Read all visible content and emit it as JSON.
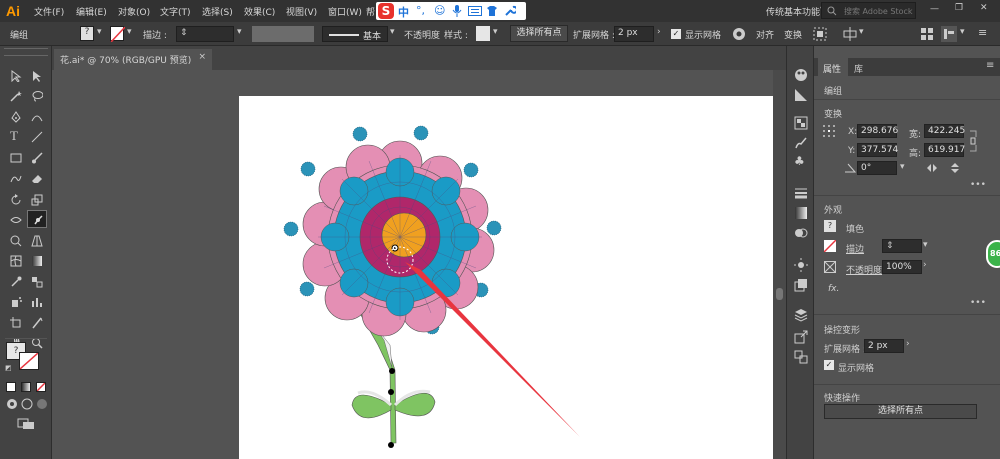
{
  "app": {
    "logo": "Ai"
  },
  "menu": [
    "文件(F)",
    "编辑(E)",
    "对象(O)",
    "文字(T)",
    "选择(S)",
    "效果(C)",
    "视图(V)",
    "窗口(W)",
    "帮"
  ],
  "ime": {
    "logo": "S",
    "mode": "中"
  },
  "workspace": "传统基本功能",
  "search": {
    "placeholder": "搜索 Adobe Stock"
  },
  "control": {
    "group_label": "编组",
    "stroke_label": "描边 :",
    "stroke_style": "基本",
    "opacity_label": "不透明度",
    "style_label": "样式 :",
    "select_all_button": "选择所有点",
    "expand_mesh_label": "扩展网格 :",
    "expand_mesh_value": "2 px",
    "show_mesh_label": "显示网格",
    "align_label": "对齐",
    "transform_label": "变换"
  },
  "document_tab": {
    "title": "花.ai* @ 70% (RGB/GPU 预览)",
    "close": "×"
  },
  "panel": {
    "tabs": [
      "属性",
      "库"
    ],
    "group_label": "编组",
    "transform_title": "变换",
    "x_label": "X:",
    "x_value": "298.676",
    "y_label": "Y:",
    "y_value": "377.574",
    "w_label": "宽:",
    "w_value": "422.245",
    "h_label": "高:",
    "h_value": "619.917",
    "angle_value": "0°",
    "more": "•••",
    "appearance_title": "外观",
    "fill_label": "填色",
    "stroke_label": "描边",
    "opacity_label": "不透明度",
    "opacity_value": "100%",
    "fx_label": "fx.",
    "puppet_title": "操控变形",
    "expand_mesh_label": "扩展网格 :",
    "expand_mesh_value": "2 px",
    "show_mesh_label": "显示网格",
    "quick_actions_title": "快速操作",
    "select_all_button": "选择所有点"
  },
  "badge": "86",
  "colors": {
    "petal_pink": "#e48fb4",
    "petal_teal": "#1a9bc6",
    "ring_magenta": "#b0276a",
    "center_orange": "#f0a020",
    "stem_green": "#7fc462",
    "arrow_red": "#e8353f",
    "dot_teal": "#2b93b8"
  }
}
